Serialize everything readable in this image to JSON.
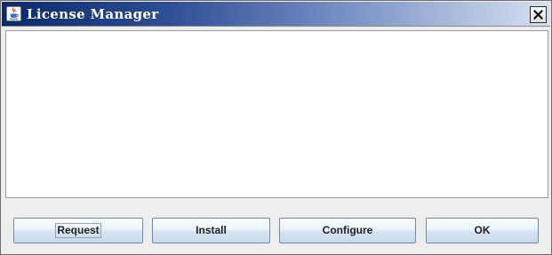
{
  "window": {
    "title": "License Manager",
    "icon": "java-coffee-icon",
    "close_icon": "close-icon"
  },
  "buttons": {
    "request_label": "Request",
    "install_label": "Install",
    "configure_label": "Configure",
    "ok_label": "OK"
  },
  "focused_button": "request",
  "colors": {
    "title_bar_start": "#0b2a6b",
    "title_bar_end": "#d7e0ef",
    "button_border": "#6f8aa8"
  }
}
